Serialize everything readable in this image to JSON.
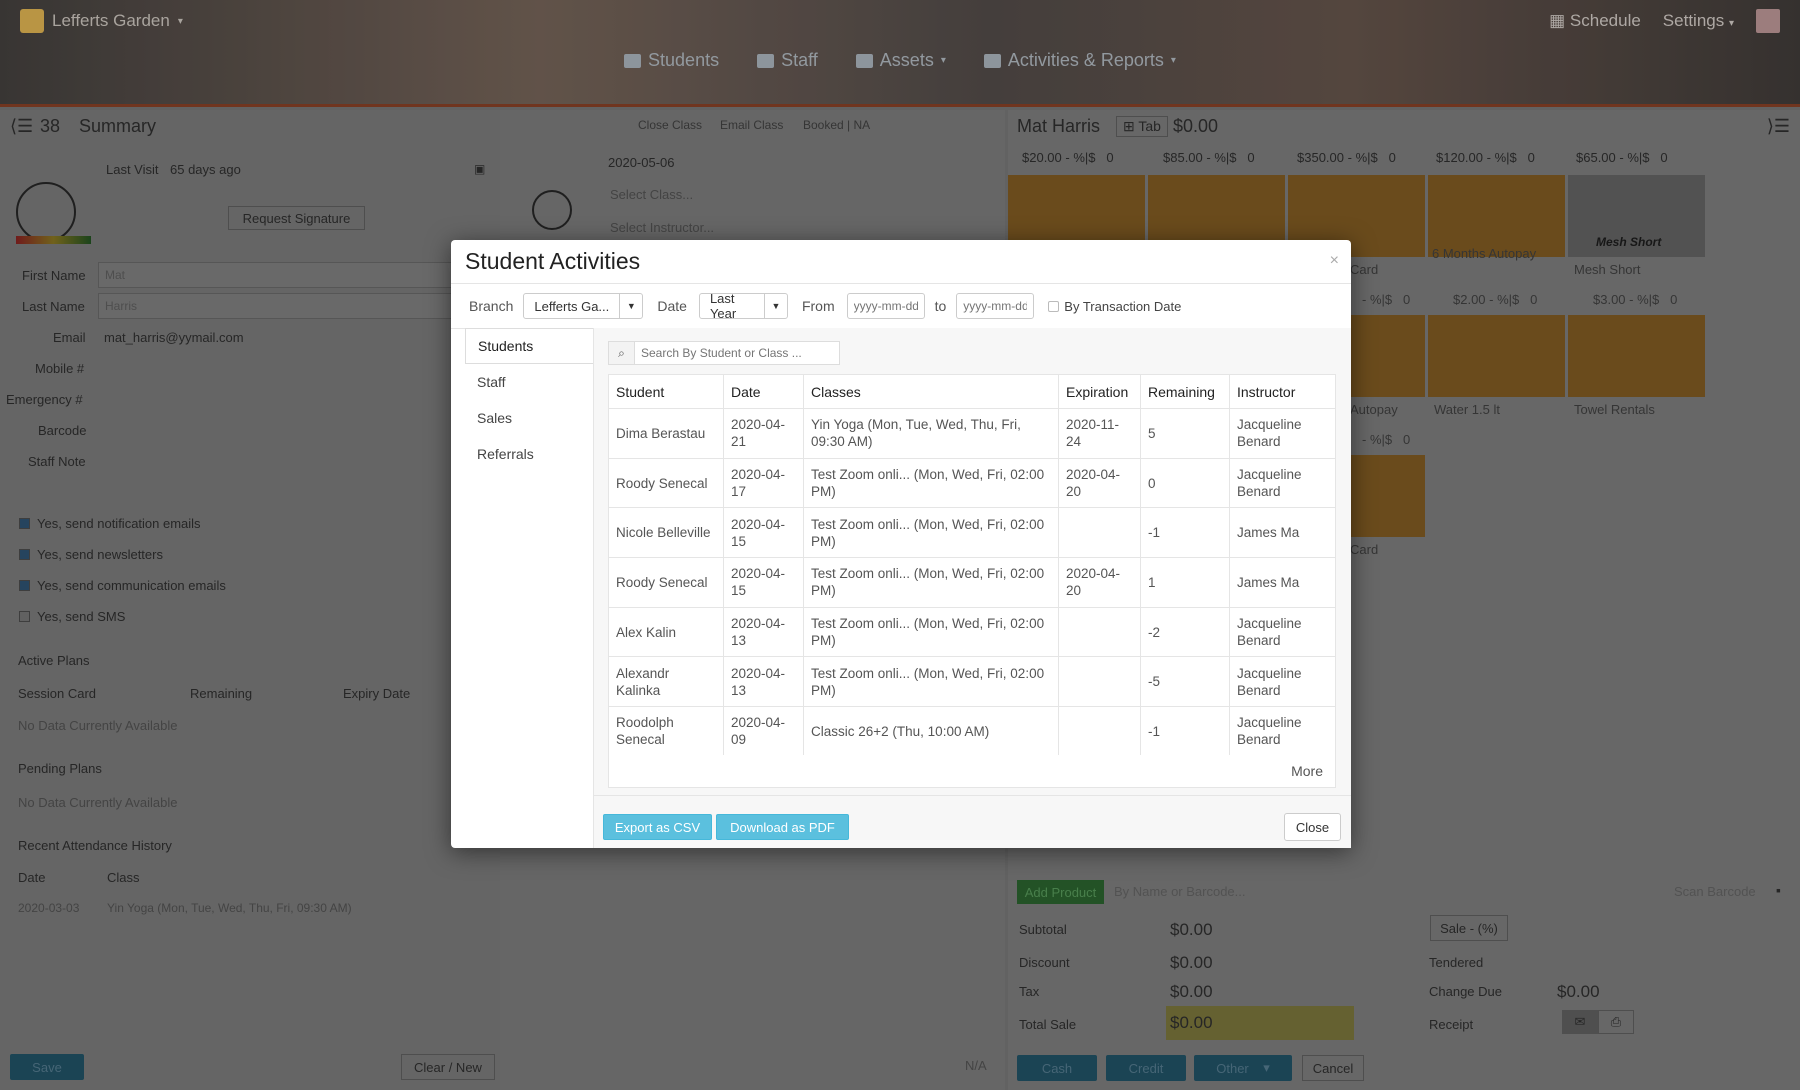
{
  "header": {
    "branch": "Lefferts Garden",
    "schedule": "Schedule",
    "settings": "Settings",
    "nav": [
      "Students",
      "Staff",
      "Assets",
      "Activities & Reports"
    ]
  },
  "left": {
    "count": "38",
    "title": "Summary",
    "last_visit_label": "Last Visit",
    "last_visit_value": "65 days ago",
    "request_signature": "Request Signature",
    "first_name_label": "First Name",
    "first_name_value": "Mat",
    "last_name_label": "Last Name",
    "last_name_value": "Harris",
    "email_label": "Email",
    "email_value": "mat_harris@yymail.com",
    "mobile_label": "Mobile #",
    "emergency_label": "Emergency #",
    "barcode_label": "Barcode",
    "staff_note_label": "Staff Note",
    "checks": [
      "Yes, send notification emails",
      "Yes, send newsletters",
      "Yes, send communication emails",
      "Yes, send SMS"
    ],
    "active_plans": "Active Plans",
    "plan_cols": [
      "Session Card",
      "Remaining",
      "Expiry Date"
    ],
    "no_data": "No Data Currently Available",
    "pending_plans": "Pending Plans",
    "no_data2": "No Data Currently Available",
    "recent_attendance": "Recent Attendance History",
    "att_cols": [
      "Date",
      "Class"
    ],
    "att_date": "2020-03-03",
    "att_class": "Yin Yoga (Mon, Tue, Wed, Thu, Fri, 09:30 AM)",
    "save": "Save",
    "clear_new": "Clear / New"
  },
  "middle": {
    "close_class": "Close Class",
    "email_class": "Email Class",
    "booked": "Booked | NA",
    "date": "2020-05-06",
    "select_class": "Select Class...",
    "select_instructor": "Select Instructor...",
    "na": "N/A"
  },
  "right": {
    "customer": "Mat Harris",
    "tab": "Tab",
    "balance": "$0.00",
    "prices": [
      "$20.00",
      "$85.00",
      "$350.00",
      "$120.00",
      "$65.00"
    ],
    "price_suffix": "- %|$",
    "price_qty": "0",
    "row2_prices": [
      "$2.00",
      "$3.00"
    ],
    "product_labels": [
      "Card",
      "6 Months Autopay",
      "Mesh Short",
      "Water 1.5 lt",
      "Towel Rentals",
      "Card",
      "Autopay"
    ],
    "mesh_overlay": "Mesh Short",
    "add_product": "Add Product",
    "by_name": "By Name or Barcode...",
    "scan_barcode": "Scan Barcode",
    "subtotal_label": "Subtotal",
    "subtotal": "$0.00",
    "discount_label": "Discount",
    "discount": "$0.00",
    "tax_label": "Tax",
    "tax": "$0.00",
    "total_label": "Total Sale",
    "total": "$0.00",
    "sale_pct": "Sale - (%)",
    "tendered": "Tendered",
    "change_due_label": "Change Due",
    "change_due": "$0.00",
    "receipt": "Receipt",
    "cash": "Cash",
    "credit": "Credit",
    "other": "Other",
    "cancel": "Cancel"
  },
  "modal": {
    "title": "Student Activities",
    "branch_label": "Branch",
    "branch_value": "Lefferts Ga...",
    "date_label": "Date",
    "date_value": "Last Year",
    "from_label": "From",
    "from_placeholder": "yyyy-mm-dd",
    "to_label": "to",
    "to_placeholder": "yyyy-mm-dd",
    "by_transaction": "By Transaction Date",
    "tabs": [
      "Students",
      "Staff",
      "Sales",
      "Referrals"
    ],
    "search_placeholder": "Search By Student or Class ...",
    "columns": [
      "Student",
      "Date",
      "Classes",
      "Expiration",
      "Remaining",
      "Instructor"
    ],
    "rows": [
      [
        "Dima Berastau",
        "2020-04-21",
        "Yin Yoga (Mon, Tue, Wed, Thu, Fri, 09:30 AM)",
        "2020-11-24",
        "5",
        "Jacqueline Benard"
      ],
      [
        "Roody Senecal",
        "2020-04-17",
        "Test Zoom onli... (Mon, Wed, Fri, 02:00 PM)",
        "2020-04-20",
        "0",
        "Jacqueline Benard"
      ],
      [
        "Nicole Belleville",
        "2020-04-15",
        "Test Zoom onli... (Mon, Wed, Fri, 02:00 PM)",
        "",
        "-1",
        "James Ma"
      ],
      [
        "Roody Senecal",
        "2020-04-15",
        "Test Zoom onli... (Mon, Wed, Fri, 02:00 PM)",
        "2020-04-20",
        "1",
        "James Ma"
      ],
      [
        "Alex Kalin",
        "2020-04-13",
        "Test Zoom onli... (Mon, Wed, Fri, 02:00 PM)",
        "",
        "-2",
        "Jacqueline Benard"
      ],
      [
        "Alexandr Kalinka",
        "2020-04-13",
        "Test Zoom onli... (Mon, Wed, Fri, 02:00 PM)",
        "",
        "-5",
        "Jacqueline Benard"
      ],
      [
        "Roodolph Senecal",
        "2020-04-09",
        "Classic 26+2 (Thu, 10:00 AM)",
        "",
        "-1",
        "Jacqueline Benard"
      ]
    ],
    "more": "More",
    "export_csv": "Export as CSV",
    "download_pdf": "Download as PDF",
    "close": "Close"
  }
}
